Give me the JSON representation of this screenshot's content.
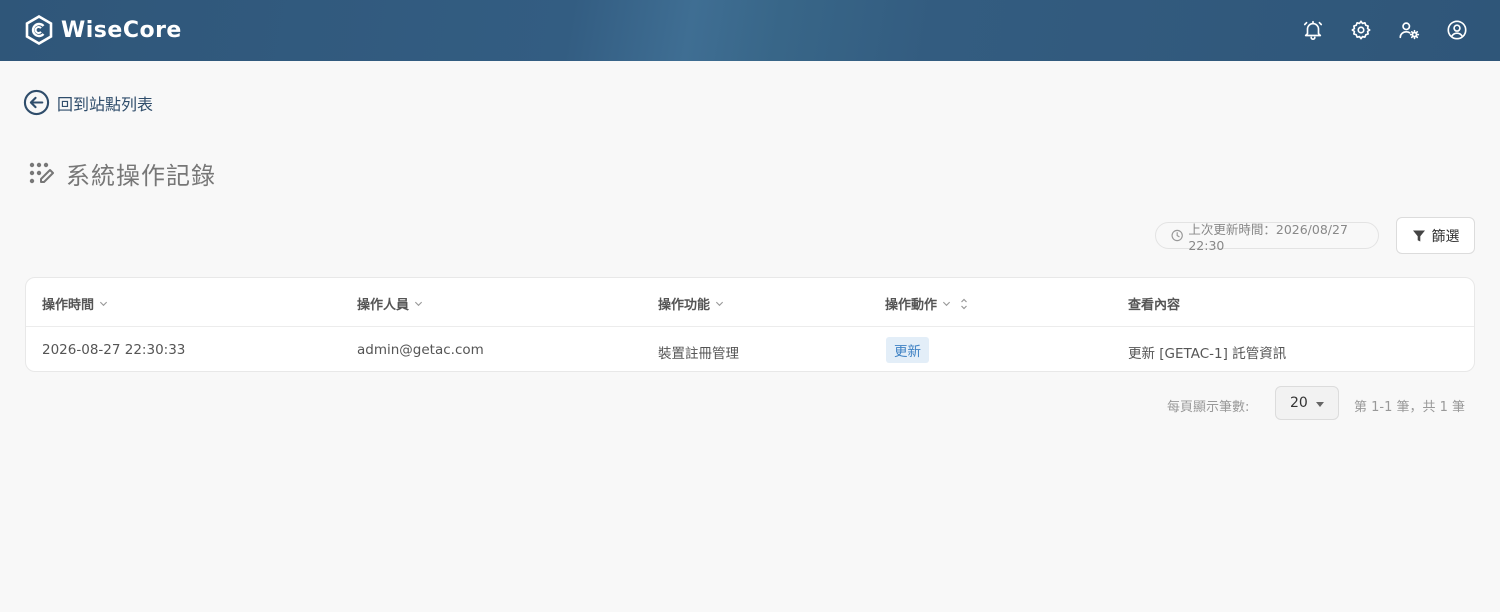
{
  "header": {
    "brand": "WiseCore",
    "icons": [
      "notification-bell-icon",
      "settings-gear-icon",
      "user-settings-icon",
      "account-icon"
    ]
  },
  "nav": {
    "back_label": "回到站點列表"
  },
  "page": {
    "title": "系統操作記錄"
  },
  "toolbar": {
    "last_updated": "上次更新時間：2026/08/27 22:30",
    "filter_label": "篩選"
  },
  "table": {
    "columns": [
      "操作時間",
      "操作人員",
      "操作功能",
      "操作動作",
      "查看內容"
    ],
    "rows": [
      {
        "time": "2026-08-27 22:30:33",
        "operator": "admin@getac.com",
        "function": "裝置註冊管理",
        "action": "更新",
        "content": "更新 [GETAC-1] 託管資訊"
      }
    ]
  },
  "pagination": {
    "per_page_label": "每頁顯示筆數:",
    "per_page_value": "20",
    "info": "第 1-1 筆，共 1 筆"
  },
  "colors": {
    "header_bg": "#2f5679",
    "accent": "#3f82c4",
    "badge_bg": "#e3eef8"
  }
}
